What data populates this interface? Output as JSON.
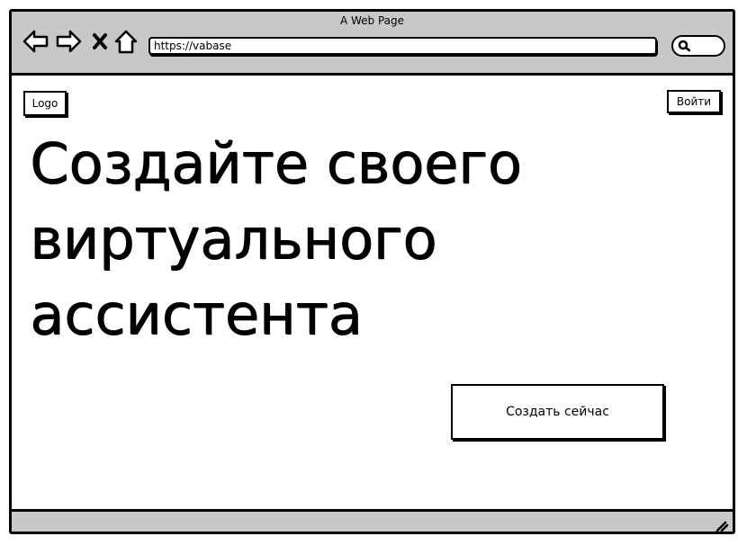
{
  "window": {
    "title": "A Web Page"
  },
  "toolbar": {
    "back_icon": "back-arrow-icon",
    "forward_icon": "forward-arrow-icon",
    "stop_icon": "close-icon",
    "home_icon": "home-icon",
    "search_icon": "search-icon"
  },
  "address_bar": {
    "url": "https://vabase"
  },
  "header": {
    "logo_label": "Logo",
    "login_label": "Войти"
  },
  "hero": {
    "title_line1": "Создайте своего",
    "title_line2": "виртуального",
    "title_line3": "ассистента",
    "cta_label": "Создать сейчас"
  },
  "colors": {
    "chrome": "#c8c8c8",
    "border": "#000000",
    "background": "#ffffff"
  }
}
